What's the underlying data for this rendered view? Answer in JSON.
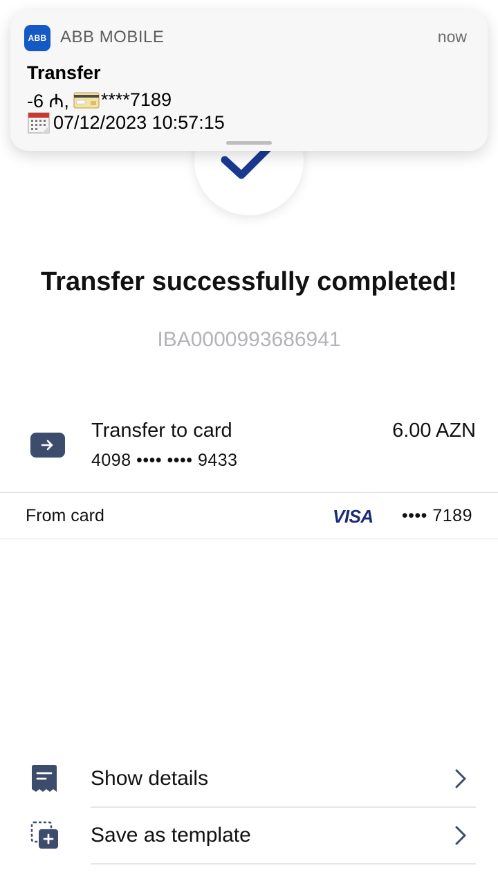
{
  "notification": {
    "app_icon_text": "ABB",
    "app_name": "ABB MOBILE",
    "time": "now",
    "title": "Transfer",
    "amount_prefix": "-6 ₼,",
    "card_masked": "****7189",
    "datetime": "07/12/2023 10:57:15"
  },
  "result": {
    "headline": "Transfer successfully completed!",
    "reference_id": "IBA0000993686941"
  },
  "transfer": {
    "title": "Transfer to card",
    "card_number": "4098 •••• •••• 9433",
    "amount": "6.00 AZN",
    "icon": "arrow-right-icon"
  },
  "source": {
    "label": "From card",
    "network": "VISA",
    "card_masked": "•••• 7189"
  },
  "actions": [
    {
      "label": "Show details",
      "icon": "receipt-icon"
    },
    {
      "label": "Save as template",
      "icon": "add-template-icon"
    }
  ],
  "colors": {
    "accent": "#1a3a8f",
    "icon_bg": "#3d4b6c",
    "notif_icon_bg": "#1559c4",
    "muted_text": "#b3b3b8"
  }
}
